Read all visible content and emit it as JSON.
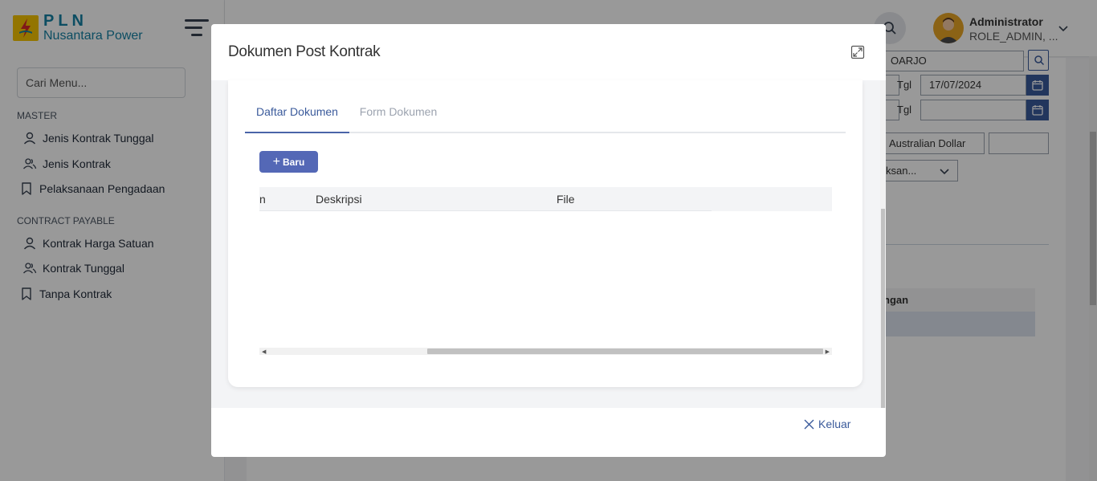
{
  "brand": {
    "line1": "PLN",
    "line2": "Nusantara Power"
  },
  "sidebar": {
    "search_placeholder": "Cari Menu...",
    "sections": [
      {
        "title": "MASTER",
        "items": [
          {
            "label": "Jenis Kontrak Tunggal",
            "icon": "user-icon"
          },
          {
            "label": "Jenis Kontrak",
            "icon": "users-icon"
          },
          {
            "label": "Pelaksanaan Pengadaan",
            "icon": "bookmark-icon"
          }
        ]
      },
      {
        "title": "CONTRACT PAYABLE",
        "items": [
          {
            "label": "Kontrak Harga Satuan",
            "icon": "user-icon"
          },
          {
            "label": "Kontrak Tunggal",
            "icon": "users-icon"
          },
          {
            "label": "Tanpa Kontrak",
            "icon": "bookmark-icon"
          }
        ]
      }
    ]
  },
  "topbar": {
    "user_name": "Administrator",
    "user_role": "ROLE_ADMIN, ..."
  },
  "background_form": {
    "location_value": "OARJO",
    "tgl_label": "Tgl",
    "tgl1_value": "17/07/2024",
    "tgl2_value": "",
    "currency_value": "Australian Dollar",
    "select_value": "ksan...",
    "table_header_fragment": "ngan"
  },
  "modal": {
    "title": "Dokumen Post Kontrak",
    "tabs": [
      {
        "label": "Daftar Dokumen",
        "active": true
      },
      {
        "label": "Form Dokumen",
        "active": false
      }
    ],
    "new_button": "Baru",
    "table_columns": [
      "n",
      "Deskripsi",
      "File"
    ],
    "footer_close": "Keluar"
  },
  "colors": {
    "primary": "#3a5a9b",
    "button": "#5468b6",
    "brand": "#1581a4",
    "logo_yellow": "#f5c400"
  }
}
